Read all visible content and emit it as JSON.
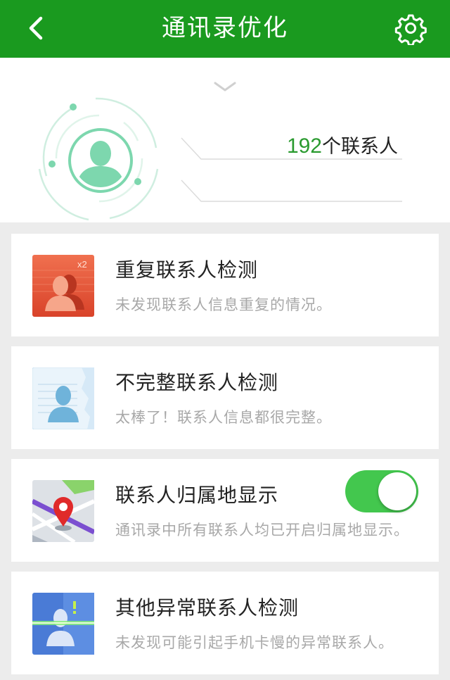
{
  "topbar": {
    "title": "通讯录优化",
    "color": "#1a9a1f"
  },
  "icons": {
    "back": "chevron-left-icon",
    "settings": "gear-icon",
    "expand": "chevron-down-icon"
  },
  "summary": {
    "count": "192",
    "count_suffix": "个联系人"
  },
  "items": [
    {
      "title": "重复联系人检测",
      "desc": "未发现联系人信息重复的情况。",
      "icon": "duplicate-contacts-icon",
      "badge": "x2"
    },
    {
      "title": "不完整联系人检测",
      "desc": "太棒了！联系人信息都很完整。",
      "icon": "incomplete-contact-icon"
    },
    {
      "title": "联系人归属地显示",
      "desc": "通讯录中所有联系人均已开启归属地显示。",
      "icon": "map-pin-icon",
      "toggle_on": true
    },
    {
      "title": "其他异常联系人检测",
      "desc": "未发现可能引起手机卡慢的异常联系人。",
      "icon": "scan-contact-icon",
      "badge": "!"
    }
  ]
}
